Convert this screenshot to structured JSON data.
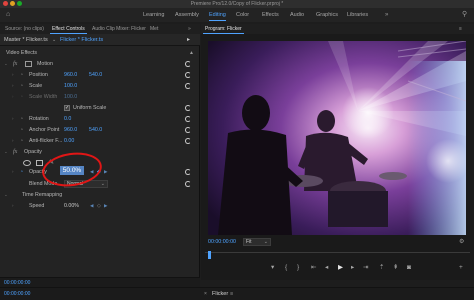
{
  "window": {
    "title": "Premiere Pro/12.0/Copy of Flicker.prproj *"
  },
  "workspaces": [
    "Learning",
    "Assembly",
    "Editing",
    "Color",
    "Effects",
    "Audio",
    "Graphics",
    "Libraries"
  ],
  "active_workspace": "Editing",
  "left_tabs": [
    "Source: (no clips)",
    "Effect Controls",
    "Audio Clip Mixer: Flicker",
    "Met"
  ],
  "left_tabs_menu_icon": "double-chevron-right-icon",
  "right_tabs": [
    "Program: Flicker"
  ],
  "right_tabs_menu_icon": "hamburger-menu-icon",
  "effect_controls": {
    "master_clip": "Master * Flicker.ts",
    "sequence_clip": "Flicker * Flicker.ts",
    "section": "Video Effects",
    "motion": {
      "label": "Motion",
      "position": {
        "label": "Position",
        "x": "960.0",
        "y": "540.0"
      },
      "scale": {
        "label": "Scale",
        "value": "100.0"
      },
      "scale_width": {
        "label": "Scale Width",
        "value": "100.0"
      },
      "uniform_scale": {
        "label": "Uniform Scale",
        "checked": true
      },
      "rotation": {
        "label": "Rotation",
        "value": "0.0"
      },
      "anchor_point": {
        "label": "Anchor Point",
        "x": "960.0",
        "y": "540.0"
      },
      "anti_flicker": {
        "label": "Anti-flicker F...",
        "value": "0.00"
      }
    },
    "opacity": {
      "label": "Opacity",
      "opacity": {
        "label": "Opacity",
        "value": "50.0%"
      },
      "blend_mode": {
        "label": "Blend Mode",
        "value": "Normal"
      }
    },
    "time_remapping": {
      "label": "Time Remapping",
      "speed": {
        "label": "Speed",
        "value": "0.00%"
      }
    },
    "footer_timecode": "00:00:00:00"
  },
  "program_monitor": {
    "timecode": "00:00:00:00",
    "fit": "Fit",
    "playhead_fraction": 0.01
  },
  "bottom_bar": {
    "sequence_tab": "Flicker",
    "timecode": "00:00:00:00"
  },
  "colors": {
    "accent": "#4fa3ff",
    "highlight_circle": "#e01616",
    "panel_bg": "#232323"
  }
}
